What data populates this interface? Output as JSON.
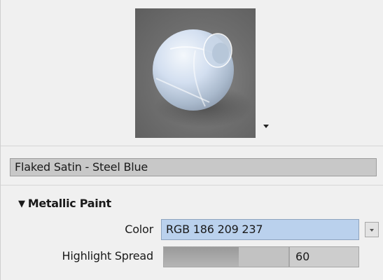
{
  "material": {
    "name": "Flaked Satin - Steel Blue"
  },
  "preview": {
    "icon": "material-sphere-preview",
    "dropdown_icon": "caret-down-icon"
  },
  "section": {
    "expander_glyph": "▼",
    "title": "Metallic Paint"
  },
  "properties": {
    "color": {
      "label": "Color",
      "value": "RGB 186 209 237",
      "swatch": "#bad1ed"
    },
    "highlight_spread": {
      "label": "Highlight Spread",
      "value": "60",
      "fill_fraction": 0.6
    }
  }
}
